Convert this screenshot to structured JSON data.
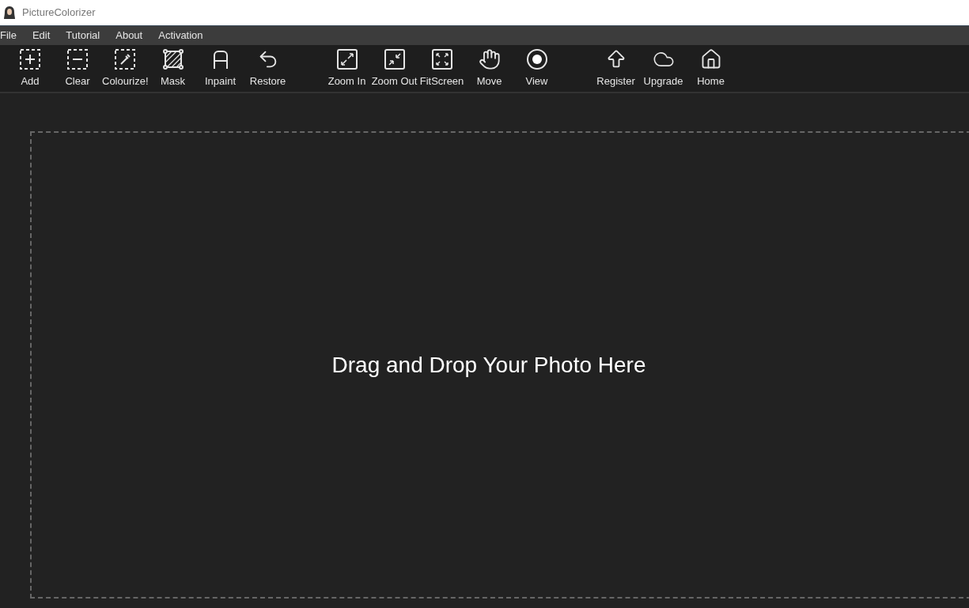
{
  "window": {
    "title": "PictureColorizer"
  },
  "menu": [
    "File",
    "Edit",
    "Tutorial",
    "About",
    "Activation"
  ],
  "toolbar": {
    "groups": [
      [
        {
          "kind": "add",
          "label": "Add"
        },
        {
          "kind": "clear",
          "label": "Clear"
        },
        {
          "kind": "colourize",
          "label": "Colourize!"
        },
        {
          "kind": "mask",
          "label": "Mask"
        },
        {
          "kind": "inpaint",
          "label": "Inpaint"
        },
        {
          "kind": "restore",
          "label": "Restore"
        }
      ],
      [
        {
          "kind": "zoomin",
          "label": "Zoom In"
        },
        {
          "kind": "zoomout",
          "label": "Zoom Out"
        },
        {
          "kind": "fit",
          "label": "FitScreen"
        },
        {
          "kind": "move",
          "label": "Move"
        },
        {
          "kind": "view",
          "label": "View"
        }
      ],
      [
        {
          "kind": "register",
          "label": "Register"
        },
        {
          "kind": "upgrade",
          "label": "Upgrade"
        },
        {
          "kind": "home",
          "label": "Home"
        }
      ]
    ]
  },
  "canvas": {
    "hint": "Drag and Drop Your Photo Here"
  }
}
